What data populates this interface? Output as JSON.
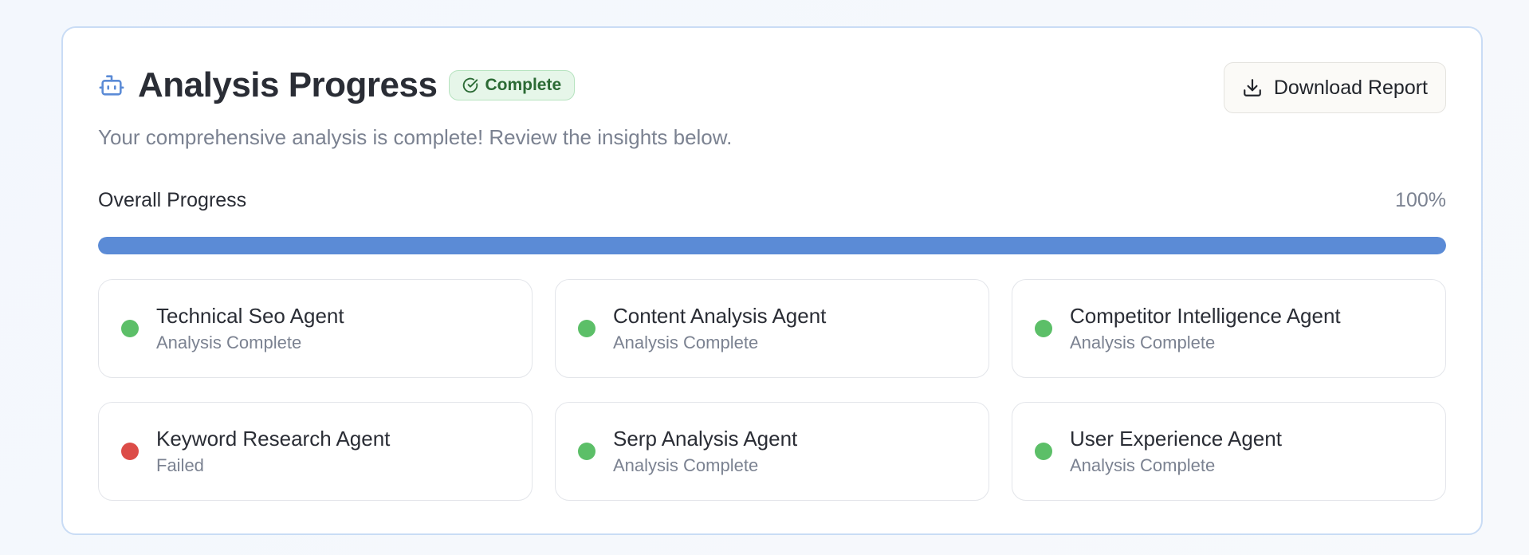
{
  "header": {
    "title": "Analysis Progress",
    "badge": "Complete",
    "download_label": "Download Report",
    "subtitle": "Your comprehensive analysis is complete! Review the insights below."
  },
  "progress": {
    "label": "Overall Progress",
    "value_text": "100%",
    "fraction": 1.0
  },
  "agents": [
    {
      "name": "Technical Seo Agent",
      "status": "Analysis Complete",
      "state": "success"
    },
    {
      "name": "Content Analysis Agent",
      "status": "Analysis Complete",
      "state": "success"
    },
    {
      "name": "Competitor Intelligence Agent",
      "status": "Analysis Complete",
      "state": "success"
    },
    {
      "name": "Keyword Research Agent",
      "status": "Failed",
      "state": "failed"
    },
    {
      "name": "Serp Analysis Agent",
      "status": "Analysis Complete",
      "state": "success"
    },
    {
      "name": "User Experience Agent",
      "status": "Analysis Complete",
      "state": "success"
    }
  ],
  "colors": {
    "accent": "#5b8bd6",
    "success": "#5cbf68",
    "failed": "#dc4c48",
    "badge_bg": "#e6f6e9",
    "badge_text": "#2b6a34"
  },
  "icons": {
    "title_icon": "robot-icon",
    "badge_icon": "check-circle-icon",
    "download_icon": "download-icon"
  }
}
